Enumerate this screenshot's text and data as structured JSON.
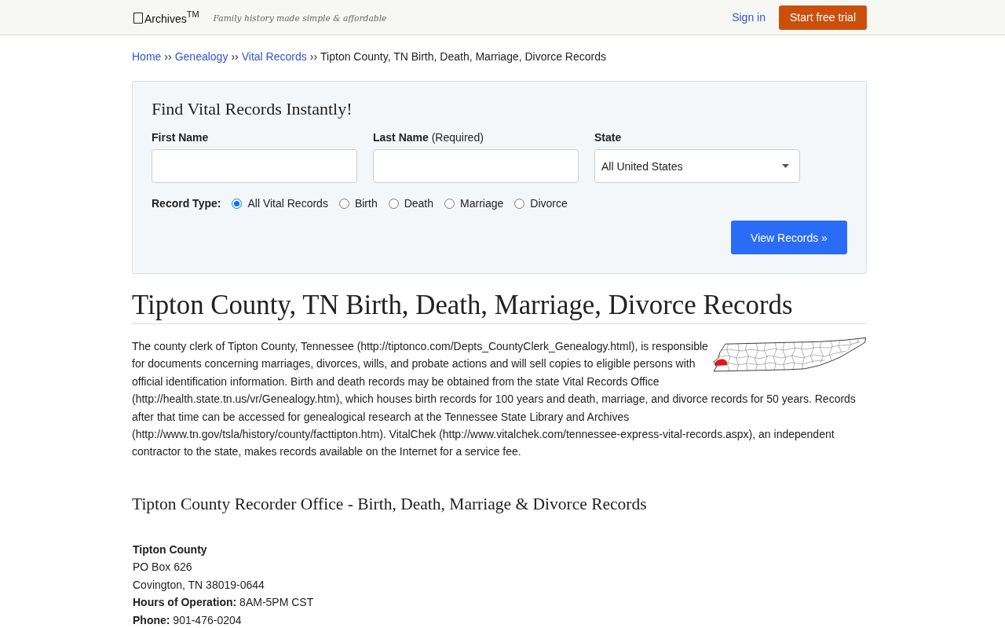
{
  "header": {
    "logo": "Archives$^{TM}$",
    "tagline": "Family history made simple & affordable",
    "sign_in": "Sign in",
    "cta": "Start free trial"
  },
  "breadcrumb": [
    {
      "kind": "link",
      "label": "Home"
    },
    {
      "kind": "separator",
      "label": "››"
    },
    {
      "kind": "link",
      "label": "Genealogy"
    },
    {
      "kind": "separator",
      "label": "››"
    },
    {
      "kind": "link",
      "label": "Vital Records"
    },
    {
      "kind": "separator",
      "label": "››"
    },
    {
      "kind": "current",
      "label": "Tipton County, TN Birth, Death, Marriage, Divorce Records"
    }
  ],
  "search": {
    "title": "Find Vital Records Instantly!",
    "fields": [
      {
        "kind": "text",
        "label": "First Name"
      },
      {
        "kind": "text",
        "label": "Last Name",
        "note": "(Required)"
      },
      {
        "kind": "select",
        "label": "State",
        "value": "All United States"
      }
    ],
    "record_type": {
      "label": "Record Type:",
      "options": [
        {
          "label": "All Vital Records",
          "selected": true
        },
        {
          "label": "Birth",
          "selected": false
        },
        {
          "label": "Death",
          "selected": false
        },
        {
          "label": "Marriage",
          "selected": false
        },
        {
          "label": "Divorce",
          "selected": false
        }
      ]
    },
    "button": "View Records »"
  },
  "article": {
    "title": "Tipton County, TN Birth, Death, Marriage, Divorce Records",
    "body": [
      "The county clerk of Tipton County, Tennessee (http://tiptonco.com/Depts_CountyClerk_Genealogy.html), is responsible for documents concerning marriages, divorces, wills, and probate actions and will sell copies to eligible persons with official identification information. Birth and death records may be obtained from the state Vital Records Office",
      "(http://health.state.tn.us/vr/Genealogy.htm), which houses birth records for 100 years and death, marriage, and divorce records for 50 years. Records after that time can be accessed for genealogical research at the Tennessee State Library and Archives (http://www.tn.gov/tsla/history/county/facttipton.htm). VitalChek (http://www.vitalchek.com/tennessee-express-vital-records.aspx), an independent contractor to the state, makes records available on the Internet for a service fee."
    ],
    "section_title": "Tipton County Recorder Office - Birth, Death, Marriage & Divorce Records",
    "office": {
      "name": "Tipton County",
      "lines": [
        "PO Box 626",
        "Covington, TN 38019-0644",
        "**Hours of Operation:** 8AM-5PM CST",
        "**Phone:** 901-476-0204"
      ]
    }
  }
}
